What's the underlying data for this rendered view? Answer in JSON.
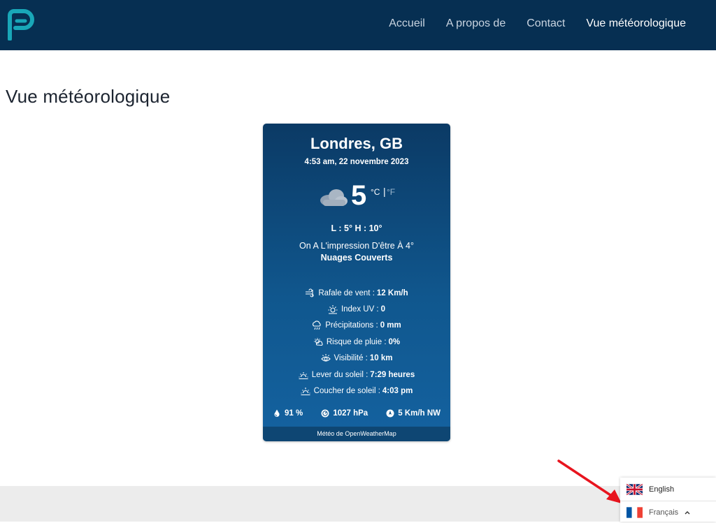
{
  "nav": {
    "items": [
      {
        "label": "Accueil"
      },
      {
        "label": "A propos de"
      },
      {
        "label": "Contact"
      },
      {
        "label": "Vue météorologique"
      }
    ]
  },
  "page": {
    "title": "Vue météorologique"
  },
  "weather": {
    "city": "Londres, GB",
    "datetime": "4:53 am, 22 novembre 2023",
    "temperature": "5",
    "unit_c": "°C",
    "unit_sep": "|",
    "unit_f": "°F",
    "low_high": "L : 5°  H : 10°",
    "feels_like": "On A L'impression D'être À 4°",
    "description": "Nuages Couverts",
    "details": [
      {
        "label": "Rafale de vent :",
        "value": "12 Km/h",
        "icon": "wind-icon"
      },
      {
        "label": "Index UV :",
        "value": "0",
        "icon": "uv-icon"
      },
      {
        "label": "Précipitations :",
        "value": "0 mm",
        "icon": "precipitation-icon"
      },
      {
        "label": "Risque de pluie :",
        "value": "0%",
        "icon": "rain-chance-icon"
      },
      {
        "label": "Visibilité :",
        "value": "10 km",
        "icon": "visibility-icon"
      },
      {
        "label": "Lever du soleil :",
        "value": "7:29 heures",
        "icon": "sunrise-icon"
      },
      {
        "label": "Coucher de soleil :",
        "value": "4:03 pm",
        "icon": "sunset-icon"
      }
    ],
    "humidity": "91 %",
    "pressure": "1027 hPa",
    "wind": "5 Km/h  NW",
    "credit": "Météo de OpenWeatherMap"
  },
  "languages": {
    "options": [
      {
        "label": "English"
      }
    ],
    "current": "Français"
  },
  "colors": {
    "header_bg": "#062f52",
    "card_top": "#0b3a65",
    "card_bottom": "#1462a0",
    "logo": "#19a7b8",
    "arrow": "#e8141e"
  }
}
